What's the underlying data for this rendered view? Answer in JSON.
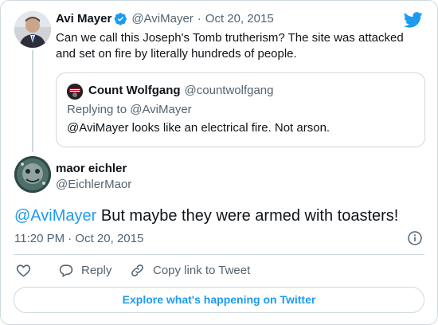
{
  "original_tweet": {
    "display_name": "Avi Mayer",
    "handle": "@AviMayer",
    "separator": "·",
    "date": "Oct 20, 2015",
    "text": "Can we call this Joseph's Tomb trutherism? The site was attacked and set on fire by literally hundreds of people."
  },
  "quoted_tweet": {
    "display_name": "Count Wolfgang",
    "handle": "@countwolfgang",
    "replying_to": "Replying to @AviMayer",
    "text": "@AviMayer looks like an electrical fire. Not arson."
  },
  "main_tweet": {
    "display_name": "maor eichler",
    "handle": "@EichlerMaor",
    "mention": "@AviMayer",
    "text": " But maybe they were armed with toasters!",
    "time": "11:20 PM · Oct 20, 2015"
  },
  "actions": {
    "reply": "Reply",
    "copy_link": "Copy link to Tweet"
  },
  "footer": {
    "explore": "Explore what's happening on Twitter"
  },
  "colors": {
    "accent": "#1d9bf0",
    "border": "#cfd9de",
    "muted": "#536471"
  }
}
